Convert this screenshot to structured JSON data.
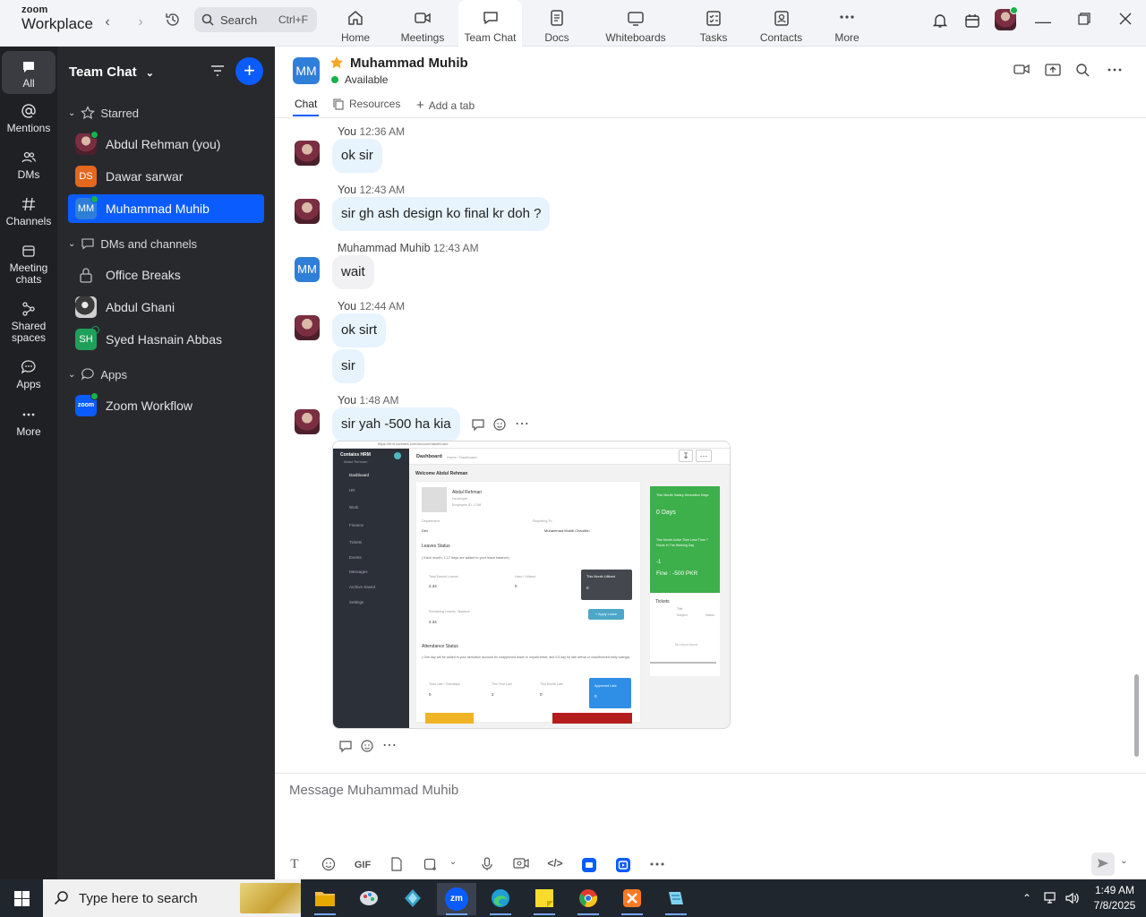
{
  "app": {
    "brand_top": "zoom",
    "brand_name": "Workplace"
  },
  "topbar": {
    "search_placeholder": "Search",
    "search_shortcut": "Ctrl+F",
    "tabs": [
      {
        "label": "Home",
        "icon": "home-icon"
      },
      {
        "label": "Meetings",
        "icon": "video-icon"
      },
      {
        "label": "Team Chat",
        "icon": "chat-icon",
        "active": true
      },
      {
        "label": "Docs",
        "icon": "doc-icon"
      },
      {
        "label": "Whiteboards",
        "icon": "whiteboard-icon"
      },
      {
        "label": "Tasks",
        "icon": "tasks-icon"
      },
      {
        "label": "Contacts",
        "icon": "contacts-icon"
      },
      {
        "label": "More",
        "icon": "more-icon"
      }
    ]
  },
  "rail": {
    "items": [
      {
        "label": "All",
        "icon": "chat-bubble-icon",
        "active": true
      },
      {
        "label": "Mentions",
        "icon": "at-icon"
      },
      {
        "label": "DMs",
        "icon": "people-icon"
      },
      {
        "label": "Channels",
        "icon": "hash-icon"
      },
      {
        "label": "Meeting chats",
        "icon": "calendar-icon"
      },
      {
        "label": "Shared spaces",
        "icon": "share-icon"
      },
      {
        "label": "Apps",
        "icon": "apps-bubble-icon"
      },
      {
        "label": "More",
        "icon": "dots-icon"
      }
    ]
  },
  "panel": {
    "title": "Team Chat",
    "sections": {
      "starred": "Starred",
      "dms": "DMs and channels",
      "apps": "Apps"
    },
    "starred_items": [
      {
        "name": "Abdul Rehman (you)",
        "avatar": "photo"
      },
      {
        "name": "Dawar sarwar",
        "avatar_text": "DS"
      },
      {
        "name": "Muhammad Muhib",
        "avatar_text": "MM",
        "selected": true
      }
    ],
    "dm_items": [
      {
        "name": "Office Breaks",
        "avatar": "lock-icon"
      },
      {
        "name": "Abdul Ghani",
        "avatar": "photo"
      },
      {
        "name": "Syed Hasnain Abbas",
        "avatar_text": "SH"
      }
    ],
    "app_items": [
      {
        "name": "Zoom Workflow",
        "avatar_text": "zoom"
      }
    ]
  },
  "chat": {
    "header": {
      "avatar_text": "MM",
      "name": "Muhammad Muhib",
      "status": "Available",
      "tabs": [
        "Chat",
        "Resources",
        "Add a tab"
      ]
    },
    "messages": [
      {
        "sender": "You",
        "time": "12:36 AM",
        "bubbles": [
          "ok sir"
        ]
      },
      {
        "sender": "You",
        "time": "12:43 AM",
        "bubbles": [
          "sir gh  ash design ko final kr doh ?"
        ]
      },
      {
        "sender": "Muhammad Muhib",
        "time": "12:43 AM",
        "avatar_text": "MM",
        "bubbles": [
          "wait"
        ]
      },
      {
        "sender": "You",
        "time": "12:44 AM",
        "bubbles": [
          "ok sirt",
          "sir"
        ]
      },
      {
        "sender": "You",
        "time": "1:48 AM",
        "bubbles": [
          "sir yah -500  ha kia"
        ]
      }
    ],
    "screenshot": {
      "brand": "Contaixs HRM",
      "subbrand": "Abdul Rehman",
      "breadcrumb": "Dashboard",
      "crumb2": "Home / Dashboard",
      "url": "https://hrm.contaixs.com/account/dashboard",
      "nav": [
        "Dashboard",
        "HR",
        "Work",
        "Finance",
        "Tickets",
        "Events",
        "Messages",
        "Archive Saved",
        "Settings"
      ],
      "welcome": "Welcome Abdul Rehman",
      "profile_name": "Abdul Rehman",
      "profile_role": "Developer",
      "profile_id": "Employee ID: 1706",
      "department_label": "Department",
      "department_value": "Dev",
      "reporting_label": "Reporting To",
      "reporting_value": "Muhammad Muhib Chaudhri",
      "leaves_title": "Leaves Status",
      "leaves_note": "( Each month, 1.17 days are added to your leave balance)",
      "total_label": "Total Earned Leaves",
      "total_value": "2.34",
      "used_label": "Used / Utilized",
      "used_value": "0",
      "month_label": "This Month Utilized",
      "month_value": "0",
      "remaining_label": "Remaining Leaves / Balance",
      "remaining_value": "2.34",
      "apply_btn": "+ Apply Leave",
      "attendance_title": "Attendance Status",
      "attendance_note": "( One day will be added to your deduction account for unapproved leave or unpaid leave, and 0.5 day for late arrival or unauthorized early outings)",
      "late_label": "Total Late / Overstays",
      "late_value": "0",
      "year_label": "This Year Late",
      "year_value": "2",
      "monthlate_label": "This Month Late",
      "monthlate_value": "0",
      "approved_label": "Approved Late",
      "approved_value": "0",
      "green_title": "This Month Salary Deduction Days",
      "green_value": "0 Days",
      "green_sub": "This Month Active Time Less Than 7 Hours In The Working Day",
      "green_count": "-1",
      "green_fine": "Fine : -500 PKR",
      "tickets_title": "Tickets",
      "tickets_cols": [
        "Title",
        "Subject",
        "Status"
      ],
      "tickets_empty": "No record found"
    }
  },
  "composer": {
    "placeholder": "Message Muhammad Muhib",
    "gif_label": "GIF"
  },
  "taskbar": {
    "search_placeholder": "Type here to search",
    "time": "1:49 AM",
    "date": "7/8/2025"
  },
  "colors": {
    "accent": "#0b5cff",
    "bubble": "#e7f3fd",
    "panel": "#28292d",
    "rail": "#1f2023",
    "online": "#16b34a",
    "fine_card": "#3daf4b"
  }
}
